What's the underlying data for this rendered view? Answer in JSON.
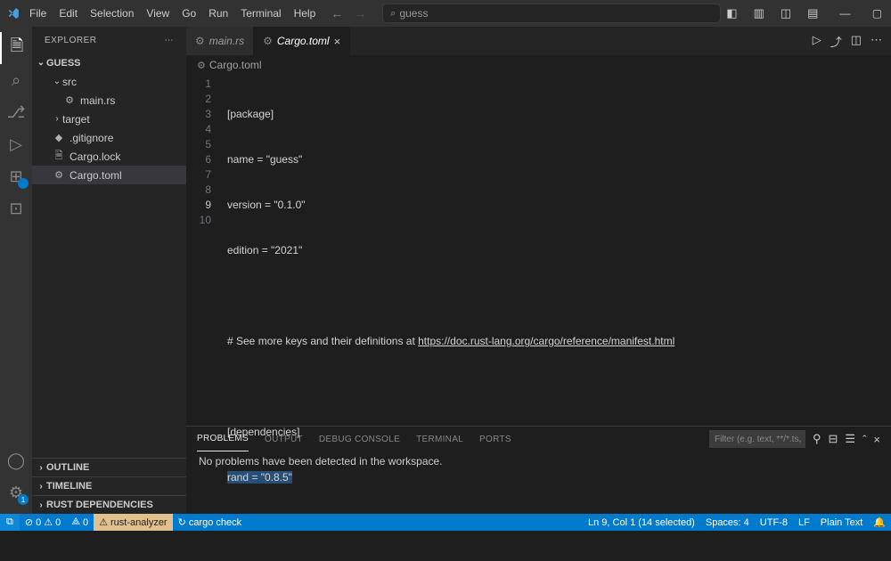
{
  "menu": {
    "items": [
      "File",
      "Edit",
      "Selection",
      "View",
      "Go",
      "Run",
      "Terminal",
      "Help"
    ]
  },
  "search": {
    "text": "guess"
  },
  "sidebar": {
    "title": "EXPLORER",
    "project": "GUESS",
    "tree": {
      "src": "src",
      "main": "main.rs",
      "target": "target",
      "gitignore": ".gitignore",
      "cargolock": "Cargo.lock",
      "cargotoml": "Cargo.toml"
    },
    "sections": {
      "outline": "OUTLINE",
      "timeline": "TIMELINE",
      "rustdeps": "RUST DEPENDENCIES"
    }
  },
  "tabs": {
    "main": "main.rs",
    "cargo": "Cargo.toml"
  },
  "breadcrumb": {
    "file": "Cargo.toml"
  },
  "editor": {
    "gutter": [
      "1",
      "2",
      "3",
      "4",
      "5",
      "6",
      "7",
      "8",
      "9",
      "10"
    ],
    "lines": {
      "l1": "[package]",
      "l2": "name = \"guess\"",
      "l3": "version = \"0.1.0\"",
      "l4": "edition = \"2021\"",
      "l5": "",
      "l6a": "# See more keys and their definitions at ",
      "l6link": "https://doc.rust-lang.org/cargo/reference/manifest.html",
      "l7": "",
      "l8": "[dependencies]",
      "l9": "rand = \"0.8.5\"",
      "l10": ""
    }
  },
  "panel": {
    "tabs": {
      "problems": "PROBLEMS",
      "output": "OUTPUT",
      "debug": "DEBUG CONSOLE",
      "terminal": "TERMINAL",
      "ports": "PORTS"
    },
    "filter_placeholder": "Filter (e.g. text, **/*.ts, !**/...",
    "message": "No problems have been detected in the workspace."
  },
  "status": {
    "errors": "0",
    "warnings": "0",
    "ports": "0",
    "rust": "rust-analyzer",
    "cargo": "cargo check",
    "ln": "Ln 9, Col 1 (14 selected)",
    "spaces": "Spaces: 4",
    "encoding": "UTF-8",
    "eol": "LF",
    "lang": "Plain Text"
  }
}
